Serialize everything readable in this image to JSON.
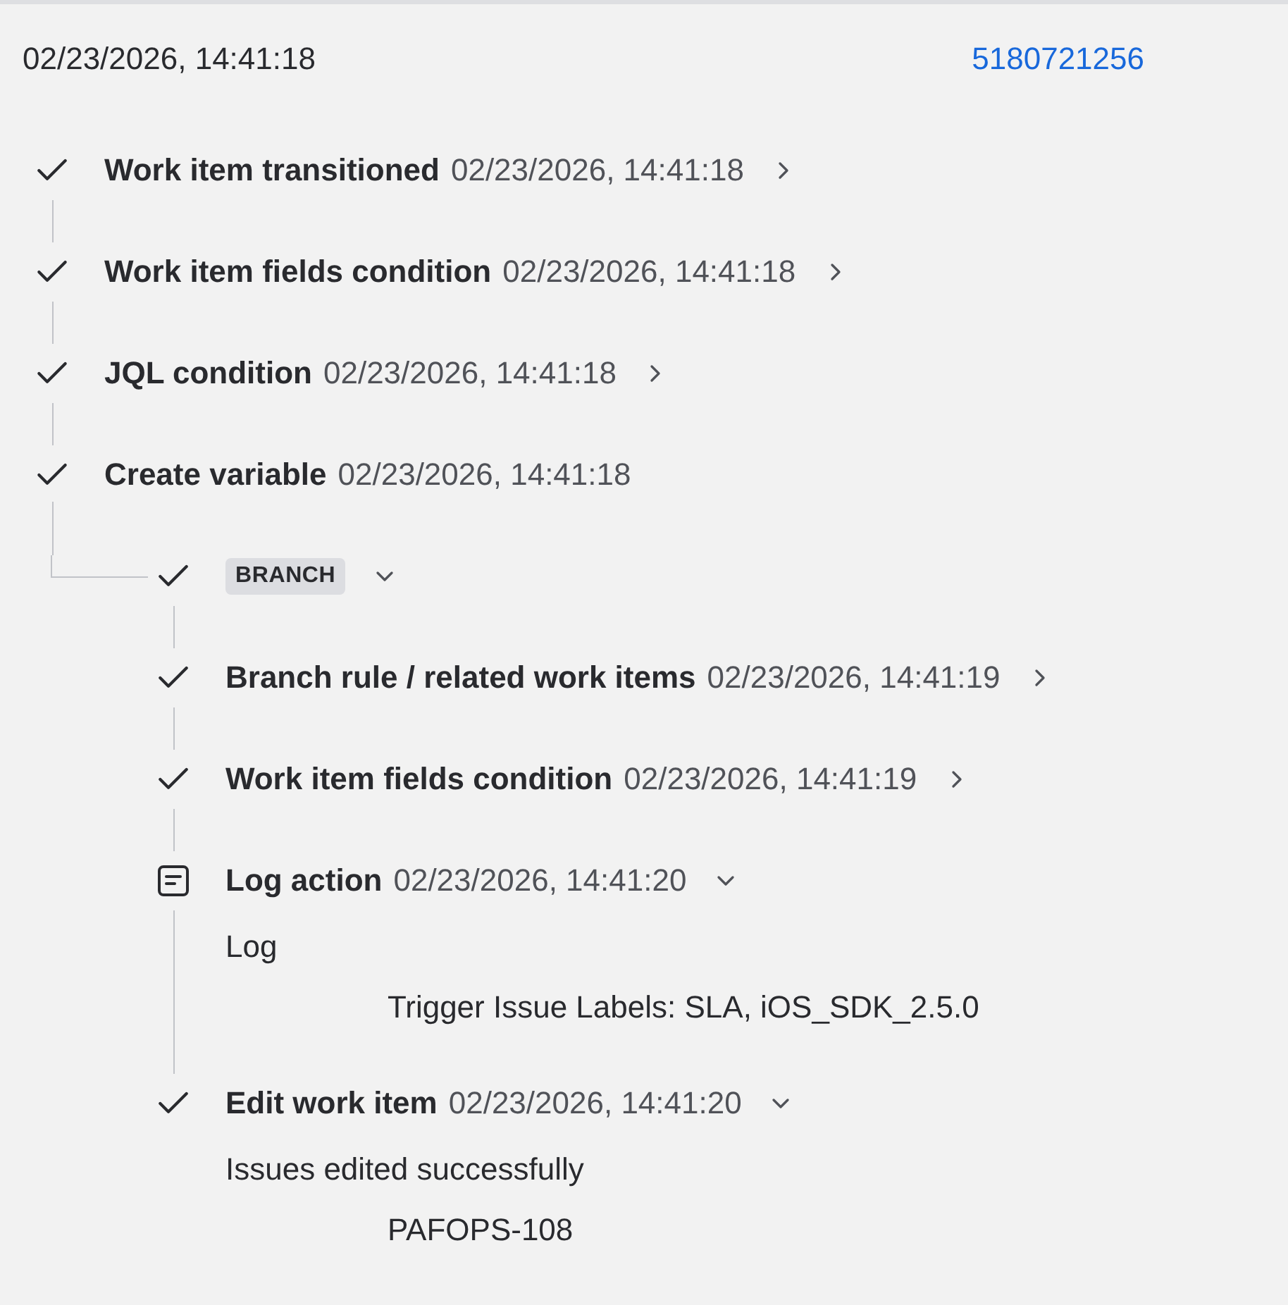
{
  "header": {
    "timestamp": "02/23/2026, 14:41:18",
    "link": "5180721256"
  },
  "steps": [
    {
      "kind": "check",
      "title": "Work item transitioned",
      "time": "02/23/2026, 14:41:18",
      "expanded": false
    },
    {
      "kind": "check",
      "title": "Work item fields condition",
      "time": "02/23/2026, 14:41:18",
      "expanded": false
    },
    {
      "kind": "check",
      "title": "JQL condition",
      "time": "02/23/2026, 14:41:18",
      "expanded": false
    },
    {
      "kind": "check",
      "title": "Create variable",
      "time": "02/23/2026, 14:41:18",
      "children": [
        {
          "kind": "branch",
          "label": "BRANCH",
          "expanded": true
        },
        {
          "kind": "check",
          "title": "Branch rule / related work items",
          "time": "02/23/2026, 14:41:19",
          "expanded": false
        },
        {
          "kind": "check",
          "title": "Work item fields condition",
          "time": "02/23/2026, 14:41:19",
          "expanded": false
        },
        {
          "kind": "log",
          "title": "Log action",
          "time": "02/23/2026, 14:41:20",
          "expanded": true,
          "details": {
            "heading": "Log",
            "value": "Trigger Issue Labels: SLA, iOS_SDK_2.5.0"
          }
        },
        {
          "kind": "check",
          "title": "Edit work item",
          "time": "02/23/2026, 14:41:20",
          "expanded": true,
          "details": {
            "heading": "Issues edited successfully",
            "value": "PAFOPS-108"
          }
        }
      ]
    }
  ]
}
